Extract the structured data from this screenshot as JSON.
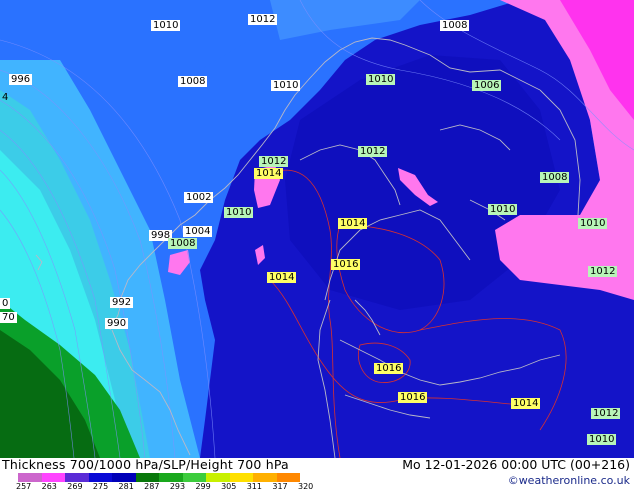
{
  "title": "Thickness 700/1000 hPa/SLP/Height 700 hPa",
  "timestamp": "Mo 12-01-2026 00:00 UTC (00+216)",
  "credit": "©weatheronline.co.uk",
  "legend": {
    "ticks": [
      "257",
      "263",
      "269",
      "275",
      "281",
      "287",
      "293",
      "299",
      "305",
      "311",
      "317",
      "320"
    ],
    "colors": [
      "#cc66cc",
      "#ff44ff",
      "#5a2bd6",
      "#0a0ad6",
      "#0000b8",
      "#08780a",
      "#19a81c",
      "#3ccc3c",
      "#c8f000",
      "#ffe000",
      "#ffb000",
      "#ff8800"
    ]
  },
  "colors": {
    "cold_mass": "#1414c8",
    "cool_blue": "#2a72ff",
    "sky_blue": "#41b4ff",
    "cyan": "#3cecf0",
    "warm_green": "#0aa02a",
    "dark_green": "#066c12",
    "pink": "#ff77ee",
    "magenta": "#ff33ee",
    "coastline": "#b8b8c8",
    "isobar_red": "#d83030"
  },
  "pressure_labels": [
    {
      "text": "1010",
      "style": "white"
    },
    {
      "text": "1012",
      "style": "white"
    },
    {
      "text": "1008",
      "style": "white"
    },
    {
      "text": "996",
      "style": "white"
    },
    {
      "text": "1008",
      "style": "white"
    },
    {
      "text": "1010",
      "style": "white"
    },
    {
      "text": "1010",
      "style": "green"
    },
    {
      "text": "1006",
      "style": "green"
    },
    {
      "text": "1012",
      "style": "green"
    },
    {
      "text": "1014",
      "style": "yellow"
    },
    {
      "text": "1012",
      "style": "green"
    },
    {
      "text": "1008",
      "style": "green"
    },
    {
      "text": "1002",
      "style": "white"
    },
    {
      "text": "1010",
      "style": "green"
    },
    {
      "text": "1010",
      "style": "green"
    },
    {
      "text": "1010",
      "style": "green"
    },
    {
      "text": "1014",
      "style": "yellow"
    },
    {
      "text": "1004",
      "style": "white"
    },
    {
      "text": "998",
      "style": "white"
    },
    {
      "text": "1008",
      "style": "green"
    },
    {
      "text": "1016",
      "style": "yellow"
    },
    {
      "text": "1014",
      "style": "yellow"
    },
    {
      "text": "1012",
      "style": "green"
    },
    {
      "text": "992",
      "style": "white"
    },
    {
      "text": "990",
      "style": "white"
    },
    {
      "text": "1016",
      "style": "yellow"
    },
    {
      "text": "1016",
      "style": "yellow"
    },
    {
      "text": "1014",
      "style": "yellow"
    },
    {
      "text": "1012",
      "style": "green"
    },
    {
      "text": "1010",
      "style": "green"
    },
    {
      "text": "4",
      "style": "plain"
    },
    {
      "text": "70",
      "style": "plain"
    },
    {
      "text": "0",
      "style": "plain"
    }
  ]
}
